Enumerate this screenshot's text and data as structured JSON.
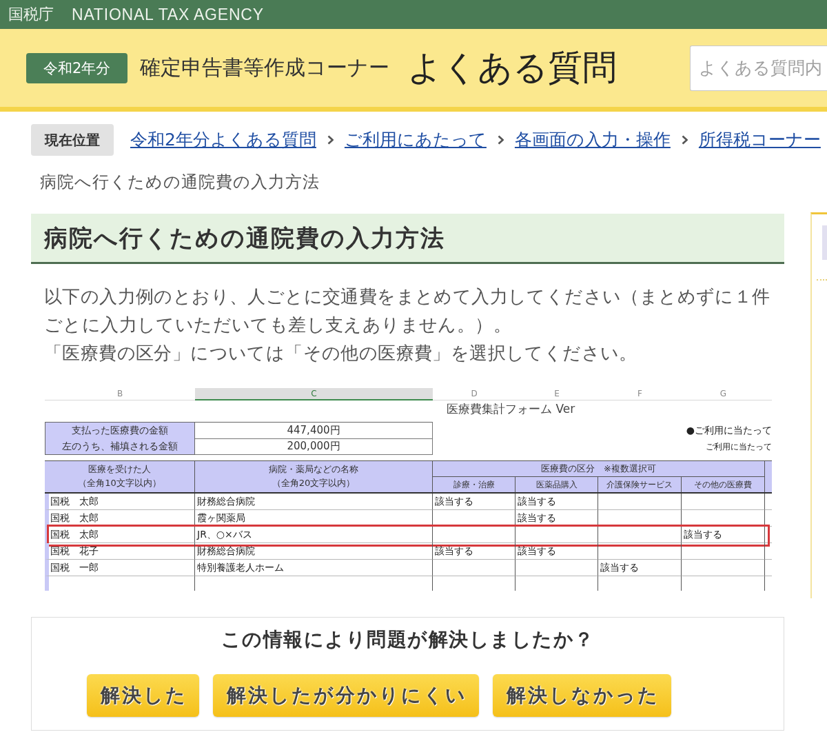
{
  "agency_bar": {
    "name_ja": "国税庁",
    "name_en": "NATIONAL TAX AGENCY"
  },
  "header": {
    "year_badge": "令和2年分",
    "section": "確定申告書等作成コーナー",
    "title": "よくある質問",
    "search": {
      "placeholder": "よくある質問内"
    }
  },
  "breadcrumb": {
    "label": "現在位置",
    "links": [
      "令和2年分よくある質問",
      "ご利用にあたって",
      "各画面の入力・操作",
      "所得税コーナー"
    ]
  },
  "current_page": "病院へ行くための通院費の入力方法",
  "article": {
    "title": "病院へ行くための通院費の入力方法",
    "paragraphs": [
      "以下の入力例のとおり、人ごとに交通費をまとめて入力してください（まとめずに１件ごとに入力していただいても差し支えありません。）。",
      "「医療費の区分」については「その他の医療費」を選択してください。"
    ]
  },
  "spreadsheet": {
    "column_letters": [
      {
        "label": "B",
        "selected": false
      },
      {
        "label": "C",
        "selected": true
      },
      {
        "label": "D",
        "selected": false
      },
      {
        "label": "E",
        "selected": false
      },
      {
        "label": "F",
        "selected": false
      },
      {
        "label": "G",
        "selected": false
      }
    ],
    "form_title": "医療費集計フォーム Ver",
    "amounts": [
      {
        "label": "支払った医療費の金額",
        "value": "447,400円"
      },
      {
        "label": "左のうち、補填される金額",
        "value": "200,000円"
      }
    ],
    "notes": [
      "●ご利用に当たって",
      "ご利用に当たって"
    ],
    "headers": {
      "recipient": [
        "医療を受けた人",
        "（全角10文字以内）"
      ],
      "facility": [
        "病院・薬局などの名称",
        "（全角20文字以内）"
      ],
      "category": "医療費の区分　※複数選択可",
      "categories": [
        "診療・治療",
        "医薬品購入",
        "介護保険サービス",
        "その他の医療費"
      ]
    },
    "rows": [
      {
        "recipient": "国税　太郎",
        "facility": "財務総合病院",
        "treatment": "該当する",
        "medicine": "該当する",
        "highlighted": false
      },
      {
        "recipient": "国税　太郎",
        "facility": "霞ヶ関薬局",
        "medicine": "該当する",
        "highlighted": false
      },
      {
        "recipient": "国税　太郎",
        "facility": "JR、○×バス",
        "other_medical": "該当する",
        "highlighted": true
      },
      {
        "recipient": "国税　花子",
        "facility": "財務総合病院",
        "treatment": "該当する",
        "medicine": "該当する",
        "highlighted": false
      },
      {
        "recipient": "国税　一郎",
        "facility": "特別養護老人ホーム",
        "nursing_care": "該当する",
        "highlighted": false
      }
    ]
  },
  "feedback": {
    "question": "この情報により問題が解決しましたか？",
    "buttons": [
      "解決した",
      "解決したが分かりにくい",
      "解決しなかった"
    ]
  }
}
